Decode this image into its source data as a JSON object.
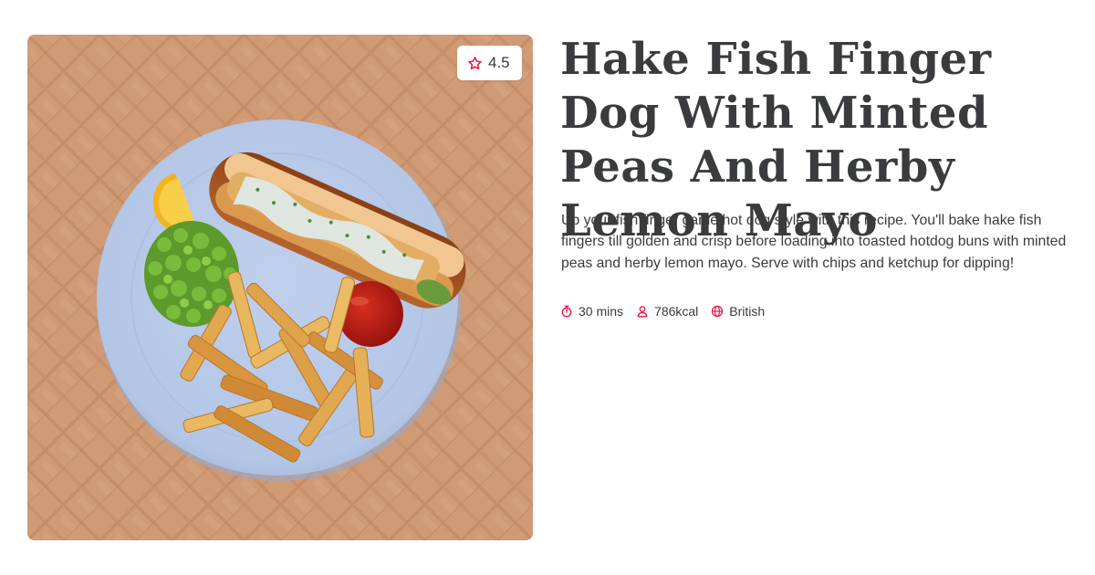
{
  "recipe": {
    "title": "Hake Fish Finger Dog With Minted Peas And Herby Lemon Mayo",
    "description": "Up your fish finger game hot dog style with this recipe. You'll bake hake fish fingers till golden and crisp before loading into toasted hotdog buns with minted peas and herby lemon mayo. Serve with chips and ketchup for dipping!",
    "rating": "4.5",
    "image_alt": "Hake fish finger dog on a blue plate with minted peas, lemon wedge, chips and ketchup"
  },
  "meta": [
    {
      "icon": "timer-icon",
      "text": "30 mins"
    },
    {
      "icon": "person-icon",
      "text": "786kcal"
    },
    {
      "icon": "globe-icon",
      "text": "British"
    }
  ],
  "colors": {
    "accent": "#e8174a",
    "title": "#3a3b3e",
    "body_text": "#3b3b3b"
  }
}
